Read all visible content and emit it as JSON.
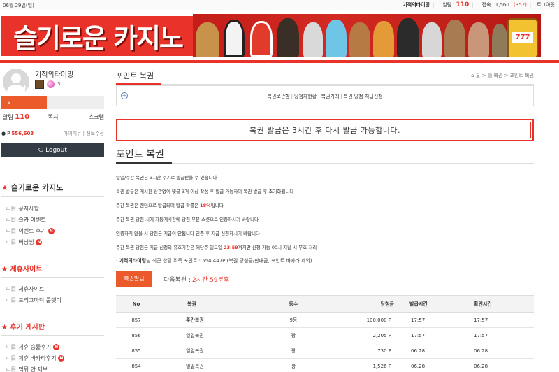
{
  "topbar": {
    "date": "06월 29일(일)",
    "nickname": "기적의타이밍",
    "alarm_label": "알림",
    "alarm_count": "110",
    "visit_label": "접속",
    "visit_total": "1,560",
    "visit_now": "(352)",
    "logout": "로그아웃"
  },
  "banner": {
    "logo_text": "슬기로운 카지노",
    "slot_text": "777"
  },
  "sidebar": {
    "profile_name": "기적의타이밍",
    "level": "3",
    "xp_value": "9",
    "xp_fraction": 0.44,
    "alarm_label": "알림",
    "alarm_count": "110",
    "memo_label": "쪽지",
    "scrap_label": "스크랩",
    "point_prefix": "P",
    "point_value": "556,603",
    "mypage": "마이페뉴",
    "edit_info": "정보수정",
    "logout_button": "Logout",
    "sections": [
      {
        "title": "슬기로운 카지노",
        "items": [
          {
            "label": "공지사항",
            "new": false
          },
          {
            "label": "슬카 이벤트",
            "new": false
          },
          {
            "label": "이벤트 후기",
            "new": true
          },
          {
            "label": "버닝썸",
            "new": true
          }
        ]
      },
      {
        "title": "제휴사이트",
        "items": [
          {
            "label": "제휴사이트",
            "new": false
          },
          {
            "label": "프리그마틱 룰렛이",
            "new": false
          }
        ]
      },
      {
        "title": "후기 게시판",
        "items": [
          {
            "label": "제휴 승률후기",
            "new": true
          },
          {
            "label": "제휴 바카라후기",
            "new": true
          },
          {
            "label": "먹튀 안 제보",
            "new": false
          }
        ]
      }
    ],
    "new_badge": "N"
  },
  "main": {
    "page_title": "포인트 복권",
    "breadcrumb": "⌂ 홈 > ▤ 복권 > 포인트 복권",
    "subnav": [
      "복권보관함",
      "당첨자현황",
      "복권거래",
      "복권 당첨 지급신청"
    ],
    "notice": "복권 발급은 3시간 후 다시 발급 가능합니다.",
    "section_title": "포인트 복권",
    "rules": [
      "일일/주간 복권은 3시간 주기로 발급받을 수 있습니다",
      "복권 발급은 게시판 상관없이 댓글 3개 이상 작성 후 발급 가능하며 복권 발급 후 초기화됩니다",
      "주간 복권은 랜덤으로 발급되며 발급 확률은 18%입니다",
      "주간 복권 당첨 시에 자동계시판에 당첨 부분 스샷으로 인증하시기 바랍니다",
      "인증하지 않을 시 당첨금 지급이 안됩니다 인증 후 지급 신청하시기 바랍니다",
      "주간 복권 당첨금 지급 신청의 유효기간은 해당주 일요일 23:59까지만 신청 가능 00시 지날 시 무효 처리"
    ],
    "rules_highlight": {
      "r4_pct": "18%",
      "r5_time": "23:59"
    },
    "last_line_prefix": "· ",
    "last_line_nick": "기적의타이밍",
    "last_line_rest": "님 최근 한달 획득 포인트 : 554,447P (복권 당첨금/판매금, 포인트 바카라 제외)",
    "issue_button": "복권발급",
    "next_label": "다음복권 :",
    "next_time": "2시간 59분후",
    "table": {
      "headers": [
        "No",
        "복권",
        "등수",
        "당첨금",
        "발급시간",
        "확인시간"
      ],
      "rows": [
        {
          "no": "857",
          "kind": "주간복권",
          "rank": "9등",
          "amount": "100,000 P",
          "issued": "17:57",
          "checked": "17:57",
          "bold": true
        },
        {
          "no": "856",
          "kind": "일일복권",
          "rank": "꽝",
          "amount": "2,205 P",
          "issued": "17:57",
          "checked": "17:57",
          "bold": false
        },
        {
          "no": "855",
          "kind": "일일복권",
          "rank": "꽝",
          "amount": "730 P",
          "issued": "06.28",
          "checked": "06.28",
          "bold": false
        },
        {
          "no": "854",
          "kind": "일일복권",
          "rank": "꽝",
          "amount": "1,526 P",
          "issued": "06.28",
          "checked": "06.28",
          "bold": false
        }
      ]
    }
  }
}
